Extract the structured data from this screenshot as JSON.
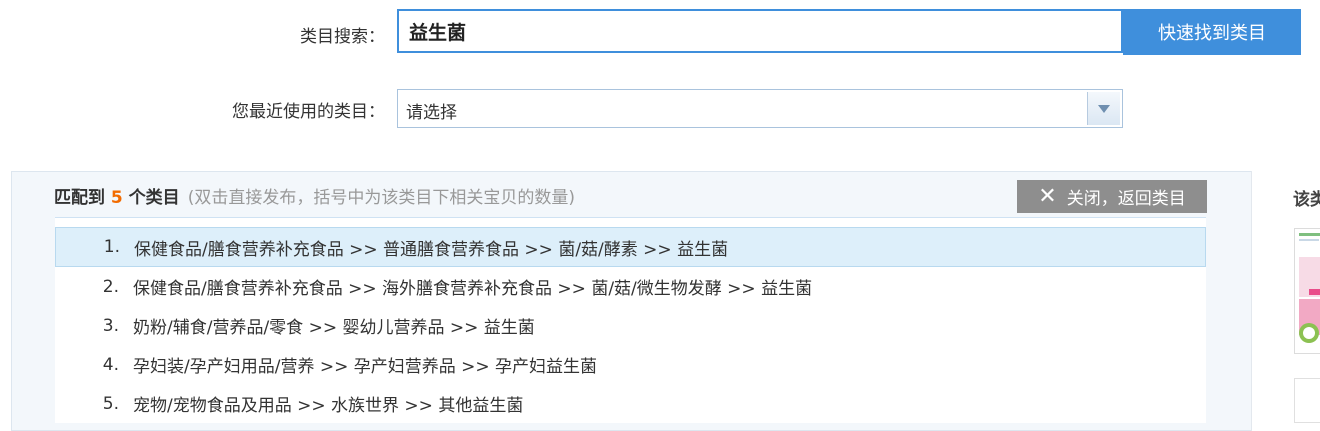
{
  "form": {
    "search_label": "类目搜索：",
    "search_value": "益生菌",
    "search_button": "快速找到类目",
    "recent_label": "您最近使用的类目：",
    "recent_value": "请选择"
  },
  "results": {
    "prefix": "匹配到",
    "count": "5",
    "suffix": "个类目",
    "hint": "(双击直接发布，括号中为该类目下相关宝贝的数量)",
    "close_label": "关闭，返回类目",
    "items": [
      {
        "index": "1.",
        "path": "保健食品/膳食营养补充食品 >> 普通膳食营养食品 >> 菌/菇/酵素 >> 益生菌"
      },
      {
        "index": "2.",
        "path": "保健食品/膳食营养补充食品 >> 海外膳食营养补充食品 >> 菌/菇/微生物发酵 >> 益生菌"
      },
      {
        "index": "3.",
        "path": "奶粉/辅食/营养品/零食 >> 婴幼儿营养品 >> 益生菌"
      },
      {
        "index": "4.",
        "path": "孕妇装/孕产妇用品/营养 >> 孕产妇营养品 >> 孕产妇益生菌"
      },
      {
        "index": "5.",
        "path": "宠物/宠物食品及用品 >> 水族世界 >> 其他益生菌"
      }
    ]
  },
  "side": {
    "title": "该类"
  },
  "colors": {
    "accent": "#3f8fdc",
    "count": "#f26b00",
    "selected_row": "#ddeffa",
    "close_button": "#8e8e8e"
  },
  "icons": {
    "dropdown": "chevron-down-icon",
    "close": "close-icon"
  }
}
